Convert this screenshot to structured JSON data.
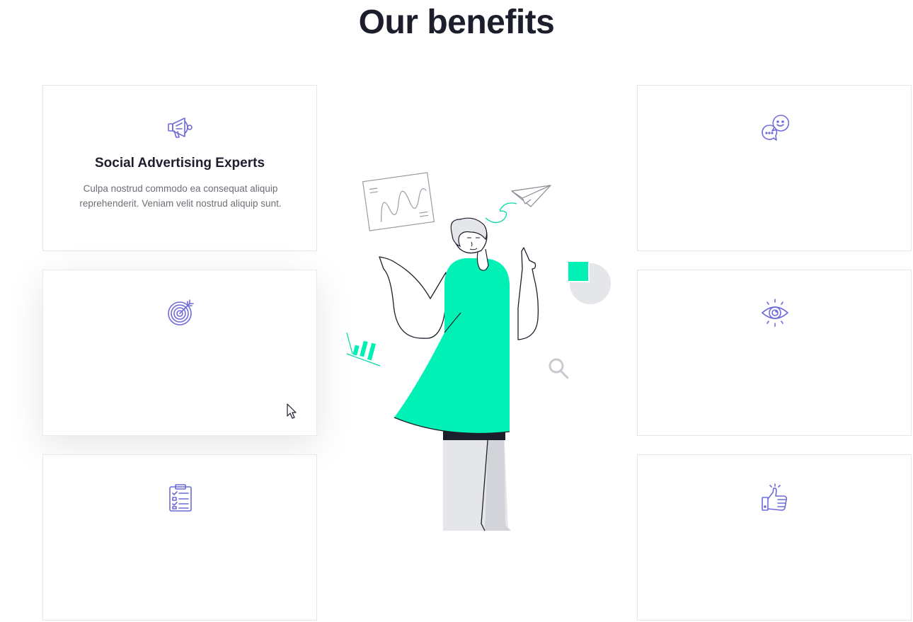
{
  "section": {
    "title": "Our benefits"
  },
  "cards": [
    {
      "id": "social-advertising",
      "icon": "megaphone-icon",
      "title": "Social Advertising Experts",
      "text": "Culpa nostrud commodo ea consequat aliquip reprehenderit. Veniam velit nostrud aliquip sunt."
    },
    {
      "id": "targeting",
      "icon": "target-icon",
      "title": "",
      "text": ""
    },
    {
      "id": "checklist",
      "icon": "clipboard-icon",
      "title": "",
      "text": ""
    },
    {
      "id": "chat",
      "icon": "chat-bubbles-icon",
      "title": "",
      "text": ""
    },
    {
      "id": "vision",
      "icon": "eye-icon",
      "title": "",
      "text": ""
    },
    {
      "id": "approval",
      "icon": "thumbs-up-icon",
      "title": "",
      "text": ""
    }
  ],
  "colors": {
    "accent_purple": "#6f6bd8",
    "accent_green": "#00f0b5",
    "heading": "#1d1e2c",
    "body_text": "#6d6e78",
    "card_border": "#e6e6ea"
  }
}
